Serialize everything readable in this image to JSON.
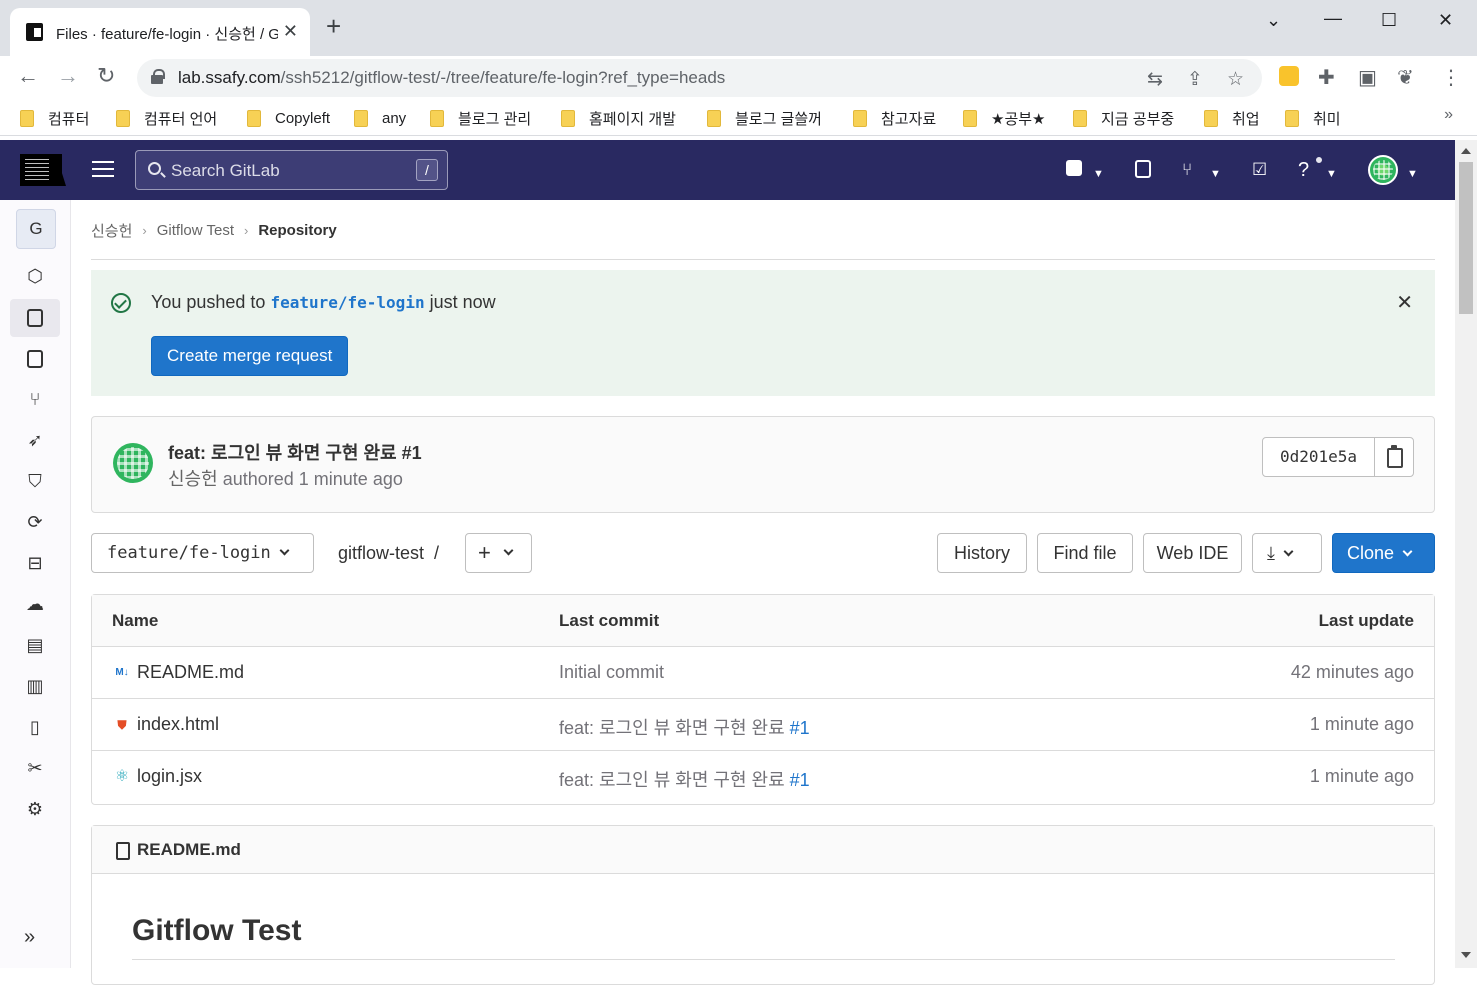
{
  "browser": {
    "tab_title": "Files · feature/fe-login · 신승헌 / Gitflow Test",
    "url_host": "lab.ssafy.com",
    "url_path": "/ssh5212/gitflow-test/-/tree/feature/fe-login?ref_type=heads",
    "bookmarks": [
      "컴퓨터",
      "컴퓨터 언어",
      "Copyleft",
      "any",
      "블로그 관리",
      "홈페이지 개발",
      "블로그 글쓸꺼",
      "참고자료",
      "★공부★",
      "지금 공부중",
      "취업",
      "취미"
    ],
    "more_bookmarks": "»"
  },
  "header": {
    "search_placeholder": "Search GitLab",
    "search_shortcut": "/"
  },
  "sidebar": {
    "project_letter": "G",
    "collapse_label": "»"
  },
  "breadcrumb": {
    "items": [
      "신승헌",
      "Gitflow Test",
      "Repository"
    ]
  },
  "alert": {
    "prefix": "You pushed to ",
    "branch": "feature/fe-login",
    "suffix": " just now",
    "button": "Create merge request"
  },
  "commit": {
    "title": "feat: 로그인 뷰 화면 구현 완료 #1",
    "author": "신승헌",
    "authored_text": "authored",
    "time": "1 minute ago",
    "sha": "0d201e5a"
  },
  "repo_toolbar": {
    "branch": "feature/fe-login",
    "path": "gitflow-test",
    "path_sep": "/",
    "history": "History",
    "find_file": "Find file",
    "web_ide": "Web IDE",
    "clone": "Clone"
  },
  "tree": {
    "columns": [
      "Name",
      "Last commit",
      "Last update"
    ],
    "rows": [
      {
        "name": "README.md",
        "icon": "markdown-icon",
        "commit": "Initial commit",
        "ref": "",
        "updated": "42 minutes ago"
      },
      {
        "name": "index.html",
        "icon": "html5-icon",
        "commit": "feat: 로그인 뷰 화면 구현 완료 ",
        "ref": "#1",
        "updated": "1 minute ago"
      },
      {
        "name": "login.jsx",
        "icon": "react-icon",
        "commit": "feat: 로그인 뷰 화면 구현 완료 ",
        "ref": "#1",
        "updated": "1 minute ago"
      }
    ]
  },
  "readme": {
    "file": "README.md",
    "heading": "Gitflow Test"
  },
  "colors": {
    "header_bg": "#292961",
    "primary": "#1f75cb",
    "success_bg": "#ecf4ee"
  }
}
